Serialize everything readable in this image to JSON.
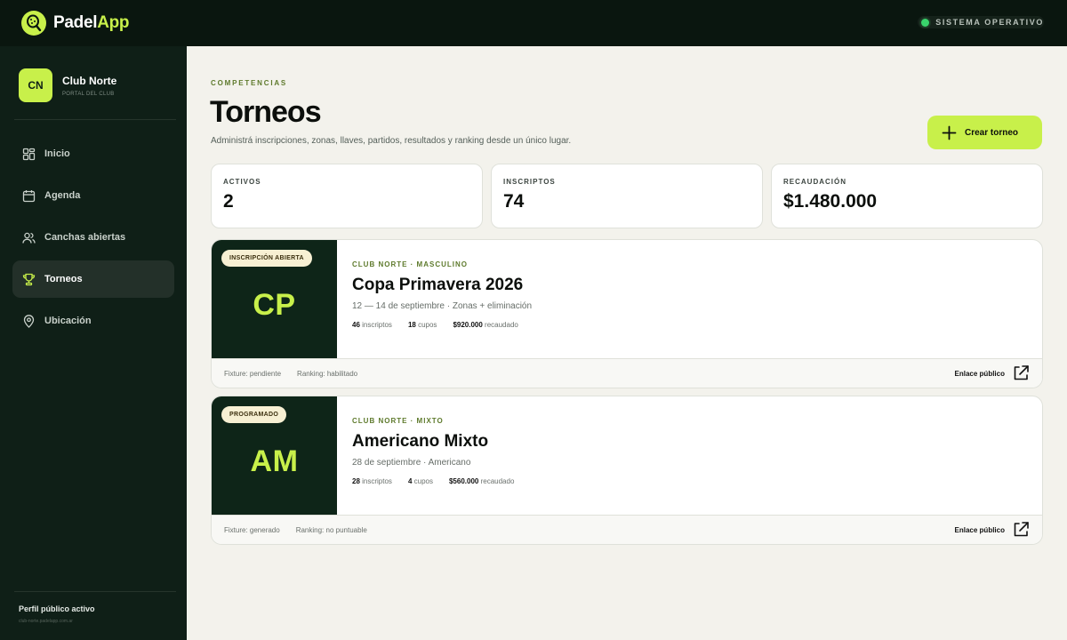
{
  "app": {
    "brand_1": "Padel",
    "brand_2": "App",
    "status": "SISTEMA OPERATIVO"
  },
  "sidebar": {
    "club_initials": "CN",
    "club_name": "Club Norte",
    "club_sub": "PORTAL DEL CLUB",
    "items": [
      {
        "label": "Inicio",
        "icon": "grid-icon"
      },
      {
        "label": "Agenda",
        "icon": "calendar-icon"
      },
      {
        "label": "Canchas abiertas",
        "icon": "users-icon"
      },
      {
        "label": "Torneos",
        "icon": "trophy-icon",
        "active": true
      },
      {
        "label": "Ubicación",
        "icon": "location-pin-icon"
      }
    ],
    "footer_title": "Perfil público activo",
    "footer_url": "club-norte.padelapp.com.ar"
  },
  "header": {
    "eyebrow": "COMPETENCIAS",
    "title": "Torneos",
    "description": "Administrá inscripciones, zonas, llaves, partidos, resultados y ranking desde un único lugar.",
    "create_button": "Crear torneo"
  },
  "stats": [
    {
      "label": "ACTIVOS",
      "value": "2"
    },
    {
      "label": "INSCRIPTOS",
      "value": "74"
    },
    {
      "label": "RECAUDACIÓN",
      "value": "$1.480.000"
    }
  ],
  "tournaments": [
    {
      "initials": "CP",
      "badge": "INSCRIPCIÓN ABIERTA",
      "eyebrow": "CLUB NORTE · MASCULINO",
      "name": "Copa Primavera 2026",
      "subtitle": "12 — 14 de septiembre · Zonas + eliminación",
      "inscriptos_value": "46",
      "inscriptos_label": "inscriptos",
      "cupos_value": "18",
      "cupos_label": "cupos",
      "recaudado_value": "$920.000",
      "recaudado_label": "recaudado",
      "fixture": "Fixture: pendiente",
      "ranking": "Ranking: habilitado",
      "link": "Enlace público"
    },
    {
      "initials": "AM",
      "badge": "PROGRAMADO",
      "eyebrow": "CLUB NORTE · MIXTO",
      "name": "Americano Mixto",
      "subtitle": "28 de septiembre · Americano",
      "inscriptos_value": "28",
      "inscriptos_label": "inscriptos",
      "cupos_value": "4",
      "cupos_label": "cupos",
      "recaudado_value": "$560.000",
      "recaudado_label": "recaudado",
      "fixture": "Fixture: generado",
      "ranking": "Ranking: no puntuable",
      "link": "Enlace público"
    }
  ]
}
